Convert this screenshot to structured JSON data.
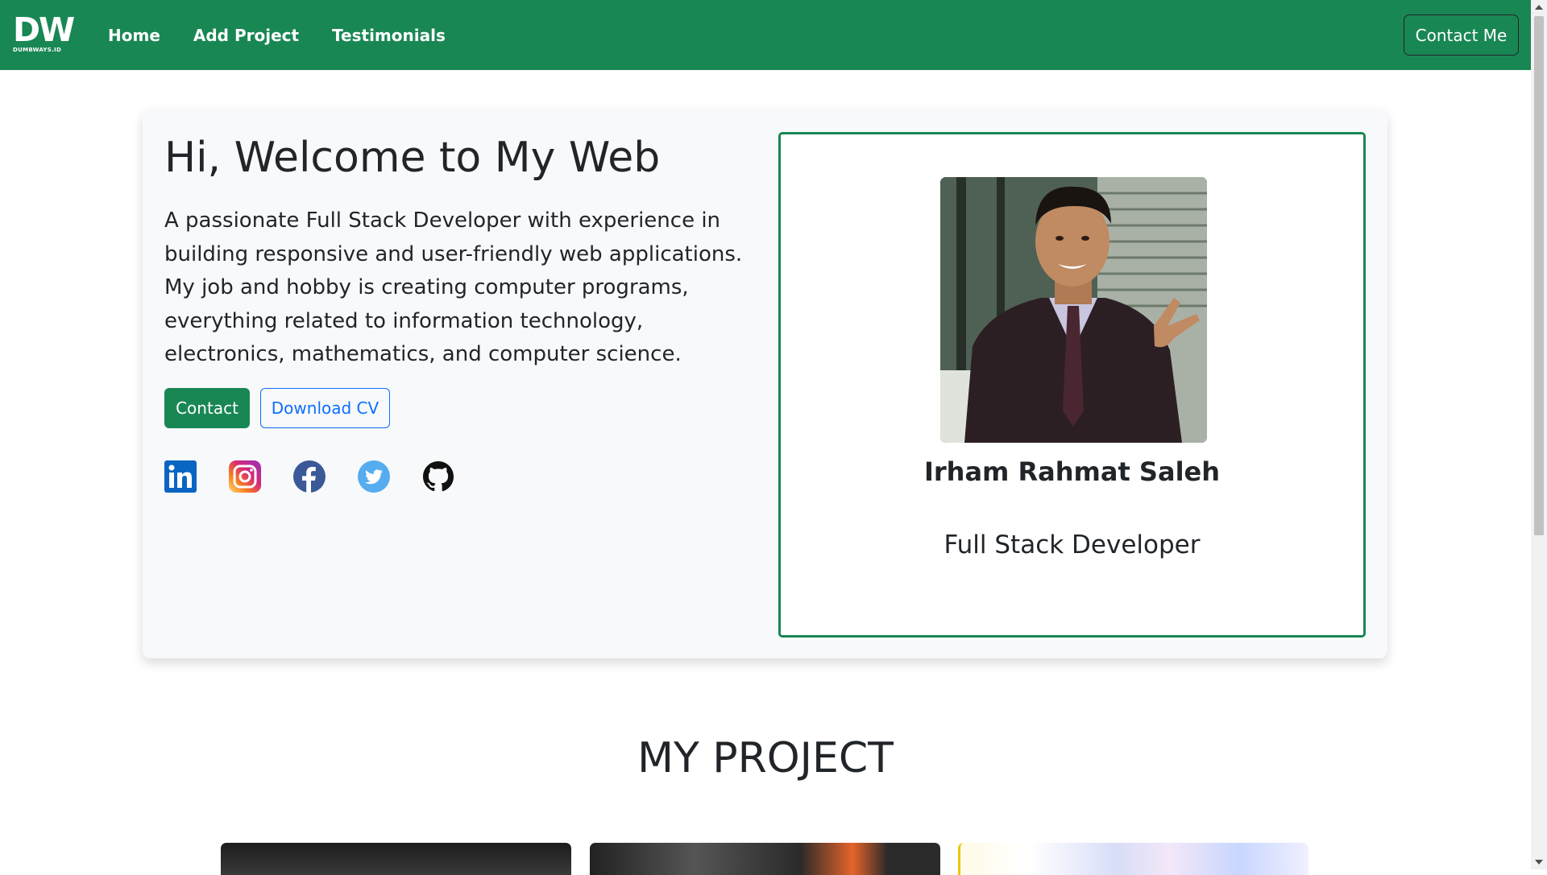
{
  "brand": {
    "mark": "DW",
    "sub": "DUMBWAYS.ID"
  },
  "nav": {
    "links": [
      "Home",
      "Add Project",
      "Testimonials"
    ],
    "contact_label": "Contact Me"
  },
  "hero": {
    "title": "Hi, Welcome to My Web",
    "description": "A passionate Full Stack Developer with experience in building responsive and user-friendly web applications. My job and hobby is creating computer programs, everything related to information technology, electronics, mathematics, and computer science.",
    "contact_button": "Contact",
    "cv_button": "Download CV",
    "socials": [
      "linkedin-icon",
      "instagram-icon",
      "facebook-icon",
      "twitter-icon",
      "github-icon"
    ]
  },
  "profile": {
    "name": "Irham Rahmat Saleh",
    "role": "Full Stack Developer"
  },
  "projects": {
    "title": "MY PROJECT"
  },
  "colors": {
    "primary": "#198754",
    "link": "#0d6efd",
    "text": "#212529",
    "card_bg": "#f8f9fa"
  }
}
